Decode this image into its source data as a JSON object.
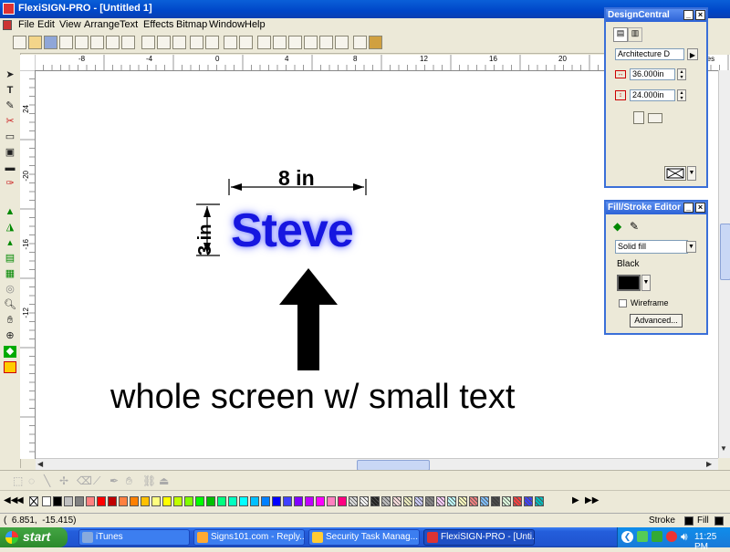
{
  "window": {
    "title": "FlexiSIGN-PRO - [Untitled 1]"
  },
  "menu": [
    "File",
    "Edit",
    "View",
    "Arrange",
    "Text",
    "Effects",
    "Bitmap",
    "Window",
    "Help"
  ],
  "ruler": {
    "top_labels": [
      "-8",
      "-4",
      "0",
      "4",
      "8",
      "12",
      "16",
      "20"
    ],
    "left_labels": [
      "24",
      "-20",
      "-16",
      "-12"
    ],
    "units_label": "inches"
  },
  "canvas": {
    "dimension_width": "8 in",
    "dimension_height": "3 in",
    "main_text": "Steve",
    "caption": "whole screen w/ small text"
  },
  "design_central": {
    "title": "DesignCentral",
    "preset": "Architecture D",
    "width_value": "36.000in",
    "height_value": "24.000in"
  },
  "fill_stroke": {
    "title": "Fill/Stroke Editor",
    "fill_type": "Solid fill",
    "color_name": "Black",
    "wireframe_label": "Wireframe",
    "advanced_label": "Advanced..."
  },
  "palette_colors": [
    "#ffffff",
    "#000000",
    "#c0c0c0",
    "#808080",
    "#ff8080",
    "#ff0000",
    "#c00000",
    "#ff8040",
    "#ff8000",
    "#ffc000",
    "#ffff80",
    "#ffff00",
    "#c0ff00",
    "#80ff00",
    "#00ff00",
    "#00c000",
    "#00ff80",
    "#00ffc0",
    "#00ffff",
    "#00c0ff",
    "#0080ff",
    "#0000ff",
    "#4040ff",
    "#8000ff",
    "#c000ff",
    "#ff00ff",
    "#ff80c0",
    "#ff0080"
  ],
  "status": {
    "coords": "(  6.851,  -15.415)",
    "stroke_label": "Stroke",
    "fill_label": "Fill"
  },
  "taskbar": {
    "start_label": "start",
    "tasks": [
      "iTunes",
      "Signs101.com - Reply...",
      "Security Task Manag...",
      "FlexiSIGN-PRO - [Unti..."
    ],
    "clock": "11:25 PM"
  },
  "colors": {
    "steve_text": "#1616e0",
    "steve_glow": "#9aa0ff",
    "title_blue": "#0046c8"
  }
}
